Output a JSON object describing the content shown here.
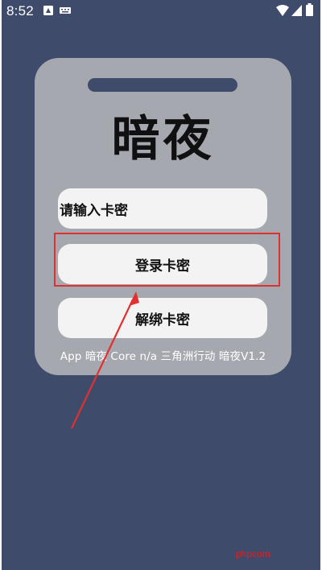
{
  "status_bar": {
    "time": "8:52",
    "icons": [
      "notification-icon",
      "keyboard-icon",
      "wifi-icon",
      "signal-icon",
      "battery-icon"
    ]
  },
  "login_card": {
    "title": "暗夜",
    "key_input_placeholder": "请输入卡密",
    "login_button_label": "登录卡密",
    "unbind_button_label": "解绑卡密",
    "footer_text": "App 暗夜 Core n/a 三角洲行动 暗夜V1.2"
  },
  "annotation": {
    "highlight_color": "#e03030",
    "watermark": "phpcom"
  },
  "colors": {
    "background": "#3f4b6b",
    "card": "#a6a8b0",
    "field": "#f3f3f3"
  }
}
